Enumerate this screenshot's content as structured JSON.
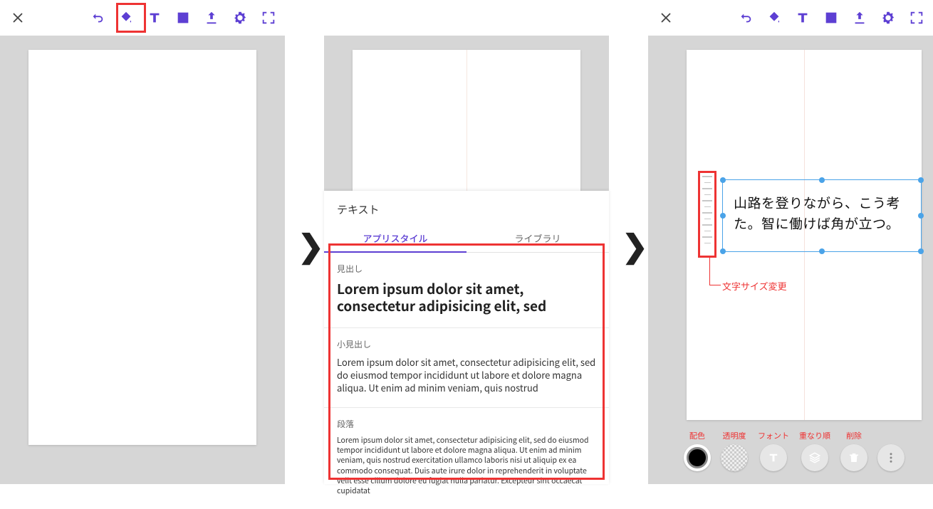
{
  "toolbar_icons": {
    "close": "close-icon",
    "undo": "undo-icon",
    "fill": "fill-icon",
    "text": "text-icon",
    "image": "image-icon",
    "upload": "upload-icon",
    "settings": "settings-icon",
    "fullscreen": "fullscreen-icon"
  },
  "arrows": "❯",
  "panel2": {
    "sheet_title": "テキスト",
    "tab_app": "アプリスタイル",
    "tab_lib": "ライブラリ",
    "heading_label": "見出し",
    "heading_sample": "Lorem ipsum dolor sit amet, consectetur adipisicing elit, sed",
    "subhead_label": "小見出し",
    "subhead_sample": "Lorem ipsum dolor sit amet, consectetur adipisicing elit, sed do eiusmod tempor incididunt ut labore et dolore magna aliqua. Ut enim ad minim veniam, quis nostrud",
    "para_label": "段落",
    "para_sample": "Lorem ipsum dolor sit amet, consectetur adipisicing elit, sed do eiusmod tempor incididunt ut labore et dolore magna aliqua. Ut enim ad minim veniam, quis nostrud exercitation ullamco laboris nisi ut aliquip ex ea commodo consequat. Duis aute irure dolor in reprehenderit in voluptate velit esse cillum dolore eu fugiat nulla pariatur. Excepteur sint occaecat cupidatat"
  },
  "panel3": {
    "text_line1": "山路を登りながら、こう考",
    "text_line2": "た。智に働けば角が立つ。",
    "size_callout": "文字サイズ変更",
    "actions": {
      "color": "配色",
      "opacity": "透明度",
      "font": "フォント",
      "order": "重なり順",
      "delete": "削除",
      "more": "more"
    }
  }
}
